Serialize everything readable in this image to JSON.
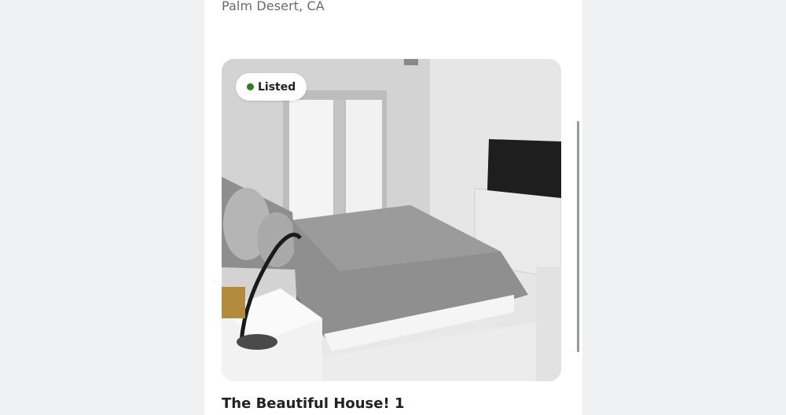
{
  "listing": {
    "location": "Palm Desert, CA",
    "status_badge": "Listed",
    "status_color": "#2f7d1e",
    "title": "The Beautiful House! 1",
    "photo_alt": "Bedroom with gray bed, french doors, TV on glass stand"
  }
}
